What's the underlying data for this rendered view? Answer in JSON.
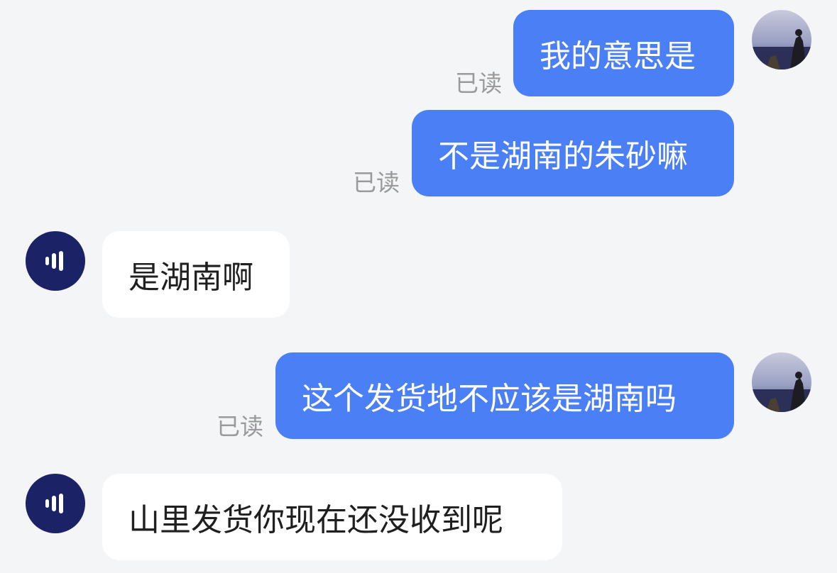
{
  "conversation": {
    "messages": [
      {
        "side": "out",
        "text": "我的意思是",
        "status": "已读"
      },
      {
        "side": "out",
        "text": "不是湖南的朱砂嘛",
        "status": "已读"
      },
      {
        "side": "in",
        "text": "是湖南啊"
      },
      {
        "side": "out",
        "text": "这个发货地不应该是湖南吗",
        "status": "已读"
      },
      {
        "side": "in",
        "text": "山里发货你现在还没收到呢"
      }
    ]
  },
  "colors": {
    "background": "#f4f5f7",
    "outgoing_bubble": "#4a7ff5",
    "incoming_bubble": "#ffffff",
    "shop_avatar": "#1b2266",
    "read_status": "#9a9a9a"
  },
  "icons": {
    "shop_avatar": "sound-wave-logo-icon",
    "user_avatar": "user-photo-avatar"
  }
}
